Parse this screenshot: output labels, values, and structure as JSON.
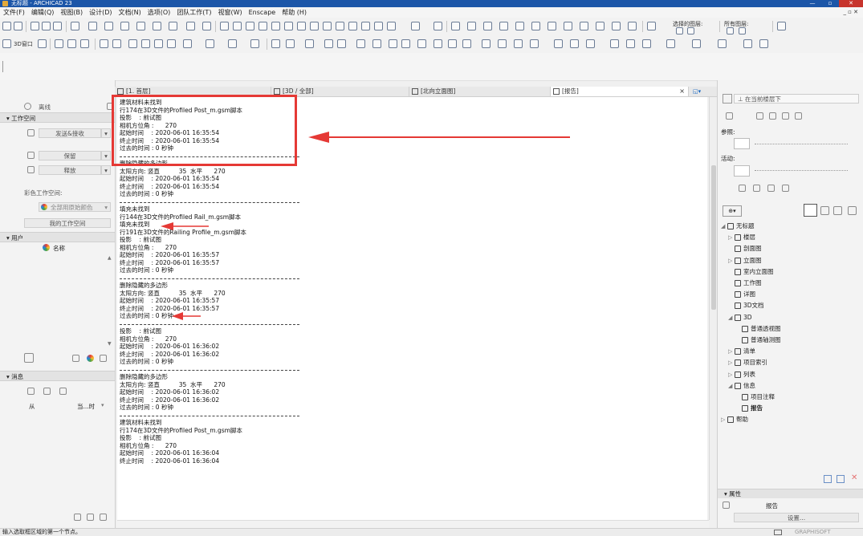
{
  "window": {
    "title": "无标题 - ARCHICAD 23"
  },
  "menu": {
    "items": [
      "文件(F)",
      "编辑(Q)",
      "视图(B)",
      "设计(D)",
      "文档(N)",
      "选项(O)",
      "团队工作(T)",
      "视窗(W)",
      "Enscape",
      "帮助 (H)"
    ],
    "right_controls": "_ ▫ ✕"
  },
  "toolbar": {
    "window_3d": "3D窗口",
    "selection_label": "选择的图层:",
    "all_layers_label": "所有图层:"
  },
  "left_panel": {
    "offline": "离线",
    "workspace_header": "工作空间",
    "send_receive": "发送&接收",
    "reserve": "保留",
    "release": "释放",
    "color_workspace": "彩色工作空间:",
    "all_original_colors": "全部用原始颜色",
    "my_workspace": "我的工作空间",
    "users_header": "用户",
    "name_label": "名称",
    "messages_header": "消息",
    "from_label": "从",
    "time_label": "当...时"
  },
  "tabs": [
    {
      "label": "[1. 首层]"
    },
    {
      "label": "[3D / 全部]"
    },
    {
      "label": "[北向立面图]"
    },
    {
      "label": "[报告]"
    }
  ],
  "report": {
    "lines": [
      "建筑材料未找到",
      "行174在3D文件的Profiled Post_m.gsm脚本",
      "投影    : 前试图",
      "相机方位角 :      270",
      "起始时间    : 2020-06-01 16:35:54",
      "终止时间    : 2020-06-01 16:35:54",
      "过去的时间 : 0 秒钟",
      "---",
      "删除隐藏的多边形",
      "太阳方向: 竖直          35  水平      270",
      "起始时间    : 2020-06-01 16:35:54",
      "终止时间    : 2020-06-01 16:35:54",
      "过去的时间 : 0 秒钟",
      "---",
      "填充未找到",
      "行144在3D文件的Profiled Rail_m.gsm脚本",
      "填充未找到",
      "行191在3D文件的Railing Profile_m.gsm脚本",
      "投影    : 前试图",
      "相机方位角 :      270",
      "起始时间    : 2020-06-01 16:35:57",
      "终止时间    : 2020-06-01 16:35:57",
      "过去的时间 : 0 秒钟",
      "---",
      "删除隐藏的多边形",
      "太阳方向: 竖直          35  水平      270",
      "起始时间    : 2020-06-01 16:35:57",
      "终止时间    : 2020-06-01 16:35:57",
      "过去的时间 : 0 秒钟",
      "---",
      "投影    : 前试图",
      "相机方位角 :      270",
      "起始时间    : 2020-06-01 16:36:02",
      "终止时间    : 2020-06-01 16:36:02",
      "过去的时间 : 0 秒钟",
      "---",
      "删除隐藏的多边形",
      "太阳方向: 竖直          35  水平      270",
      "起始时间    : 2020-06-01 16:36:02",
      "终止时间    : 2020-06-01 16:36:02",
      "过去的时间 : 0 秒钟",
      "---",
      "建筑材料未找到",
      "行174在3D文件的Profiled Post_m.gsm脚本",
      "投影    : 前试图",
      "相机方位角 :      270",
      "起始时间    : 2020-06-01 16:36:04",
      "终止时间    : 2020-06-01 16:36:04"
    ]
  },
  "right_panel": {
    "current_floor": "在当前楼层下",
    "reference_label": "参照:",
    "active_label": "活动:",
    "tree": [
      {
        "label": "无标题",
        "indent": 0,
        "arrow": "◢"
      },
      {
        "label": "楼层",
        "indent": 1,
        "arrow": "▷"
      },
      {
        "label": "剖面图",
        "indent": 1,
        "arrow": ""
      },
      {
        "label": "立面图",
        "indent": 1,
        "arrow": "▷"
      },
      {
        "label": "室内立面图",
        "indent": 1,
        "arrow": ""
      },
      {
        "label": "工作图",
        "indent": 1,
        "arrow": ""
      },
      {
        "label": "详图",
        "indent": 1,
        "arrow": ""
      },
      {
        "label": "3D文档",
        "indent": 1,
        "arrow": ""
      },
      {
        "label": "3D",
        "indent": 1,
        "arrow": "◢"
      },
      {
        "label": "普通透视图",
        "indent": 2,
        "arrow": ""
      },
      {
        "label": "普通轴测图",
        "indent": 2,
        "arrow": ""
      },
      {
        "label": "清单",
        "indent": 1,
        "arrow": "▷"
      },
      {
        "label": "项目索引",
        "indent": 1,
        "arrow": "▷"
      },
      {
        "label": "列表",
        "indent": 1,
        "arrow": "▷"
      },
      {
        "label": "信息",
        "indent": 1,
        "arrow": "◢"
      },
      {
        "label": "项目注释",
        "indent": 2,
        "arrow": ""
      },
      {
        "label": "报告",
        "indent": 2,
        "arrow": "",
        "selected": true
      },
      {
        "label": "帮助",
        "indent": 0,
        "arrow": "▷"
      }
    ],
    "properties_header": "属性",
    "properties_value": "报告",
    "settings_button": "设置..."
  },
  "status_bar": {
    "hint": "输入选取框区域的第一个节点。",
    "brand": "GRAPHISOFT"
  },
  "colors": {
    "annotation": "#e53935",
    "title_bar": "#1c56a8"
  }
}
